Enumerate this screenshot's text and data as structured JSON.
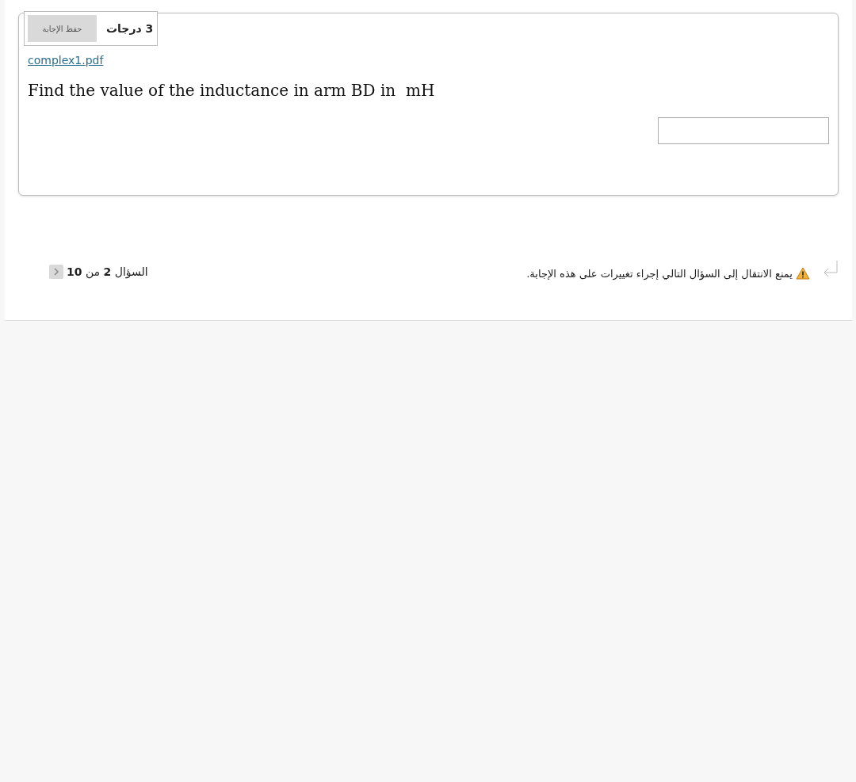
{
  "question": {
    "points": "3 درجات",
    "save_button": "حفظ الإجابة",
    "attachment": "complex1.pdf ",
    "text": "Find the value of the inductance in arm BD in  mH"
  },
  "navigation": {
    "warning": "يمنع الانتقال إلى السؤال التالي إجراء تغييرات على هذه الإجابة.",
    "counter": "السؤال **2** من **10**"
  }
}
